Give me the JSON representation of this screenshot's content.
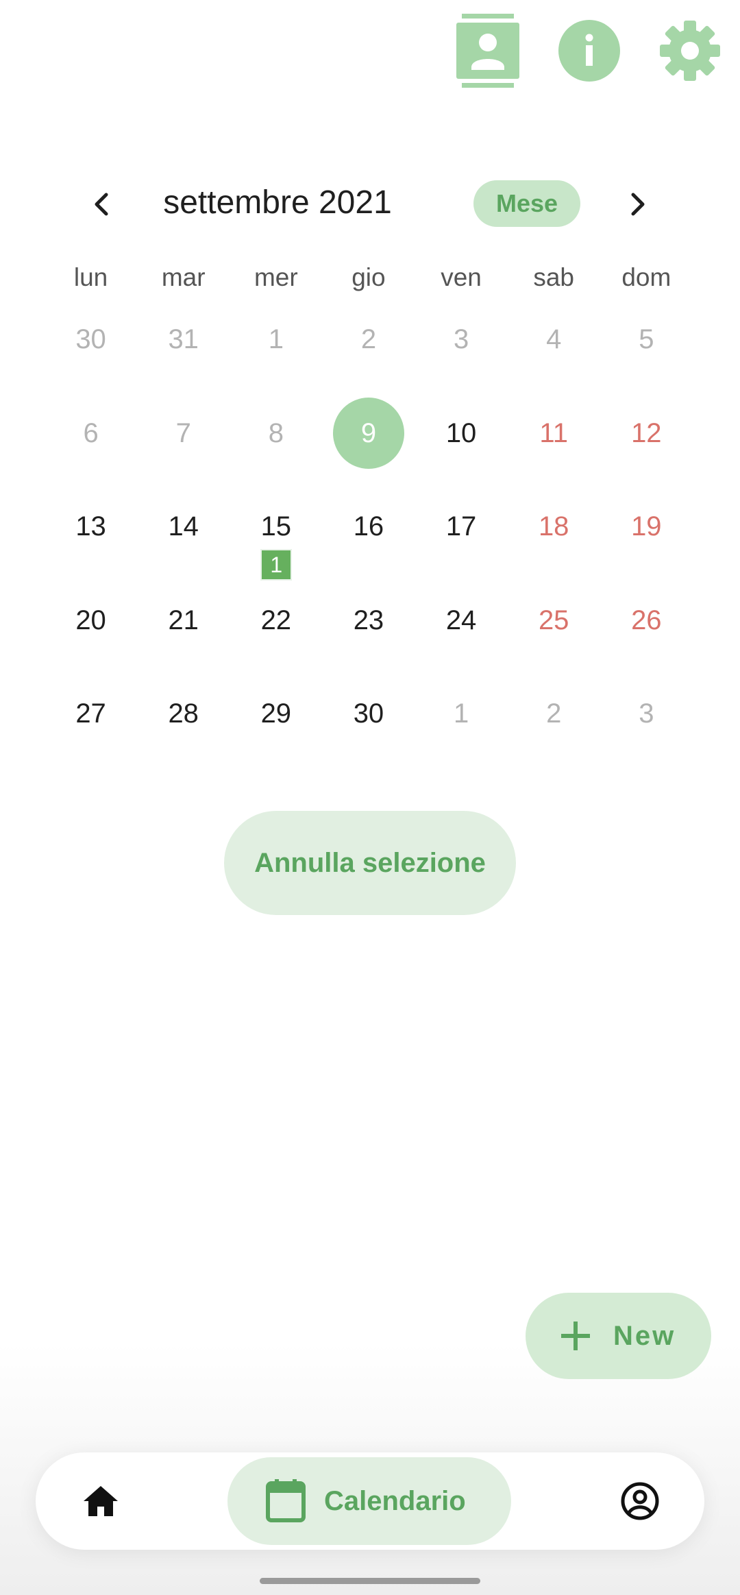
{
  "colors": {
    "accent_green": "#5aa55f",
    "light_green": "#a5d6a7",
    "weekend_red": "#d9726a",
    "muted_gray": "#b3b3b3"
  },
  "top_bar": {
    "icons": [
      "contacts-icon",
      "info-icon",
      "settings-icon"
    ]
  },
  "calendar": {
    "month_label": "settembre 2021",
    "view_toggle": "Mese",
    "weekdays": [
      "lun",
      "mar",
      "mer",
      "gio",
      "ven",
      "sab",
      "dom"
    ],
    "weeks": [
      [
        {
          "d": "30",
          "s": "muted"
        },
        {
          "d": "31",
          "s": "muted"
        },
        {
          "d": "1",
          "s": "muted"
        },
        {
          "d": "2",
          "s": "muted"
        },
        {
          "d": "3",
          "s": "muted"
        },
        {
          "d": "4",
          "s": "muted"
        },
        {
          "d": "5",
          "s": "muted"
        }
      ],
      [
        {
          "d": "6",
          "s": "muted"
        },
        {
          "d": "7",
          "s": "muted"
        },
        {
          "d": "8",
          "s": "muted"
        },
        {
          "d": "9",
          "s": "selected"
        },
        {
          "d": "10",
          "s": "normal"
        },
        {
          "d": "11",
          "s": "weekend"
        },
        {
          "d": "12",
          "s": "weekend"
        }
      ],
      [
        {
          "d": "13",
          "s": "normal"
        },
        {
          "d": "14",
          "s": "normal"
        },
        {
          "d": "15",
          "s": "normal",
          "badge": "1"
        },
        {
          "d": "16",
          "s": "normal"
        },
        {
          "d": "17",
          "s": "normal"
        },
        {
          "d": "18",
          "s": "weekend"
        },
        {
          "d": "19",
          "s": "weekend"
        }
      ],
      [
        {
          "d": "20",
          "s": "normal"
        },
        {
          "d": "21",
          "s": "normal"
        },
        {
          "d": "22",
          "s": "normal"
        },
        {
          "d": "23",
          "s": "normal"
        },
        {
          "d": "24",
          "s": "normal"
        },
        {
          "d": "25",
          "s": "weekend"
        },
        {
          "d": "26",
          "s": "weekend"
        }
      ],
      [
        {
          "d": "27",
          "s": "normal"
        },
        {
          "d": "28",
          "s": "normal"
        },
        {
          "d": "29",
          "s": "normal"
        },
        {
          "d": "30",
          "s": "normal"
        },
        {
          "d": "1",
          "s": "muted"
        },
        {
          "d": "2",
          "s": "muted"
        },
        {
          "d": "3",
          "s": "muted"
        }
      ]
    ],
    "clear_selection_label": "Annulla selezione"
  },
  "fab": {
    "label": "New",
    "icon": "plus-icon"
  },
  "bottom_nav": {
    "items": [
      {
        "icon": "home-icon",
        "label": ""
      },
      {
        "icon": "calendar-icon",
        "label": "Calendario",
        "active": true
      },
      {
        "icon": "account-circle-icon",
        "label": ""
      }
    ]
  }
}
